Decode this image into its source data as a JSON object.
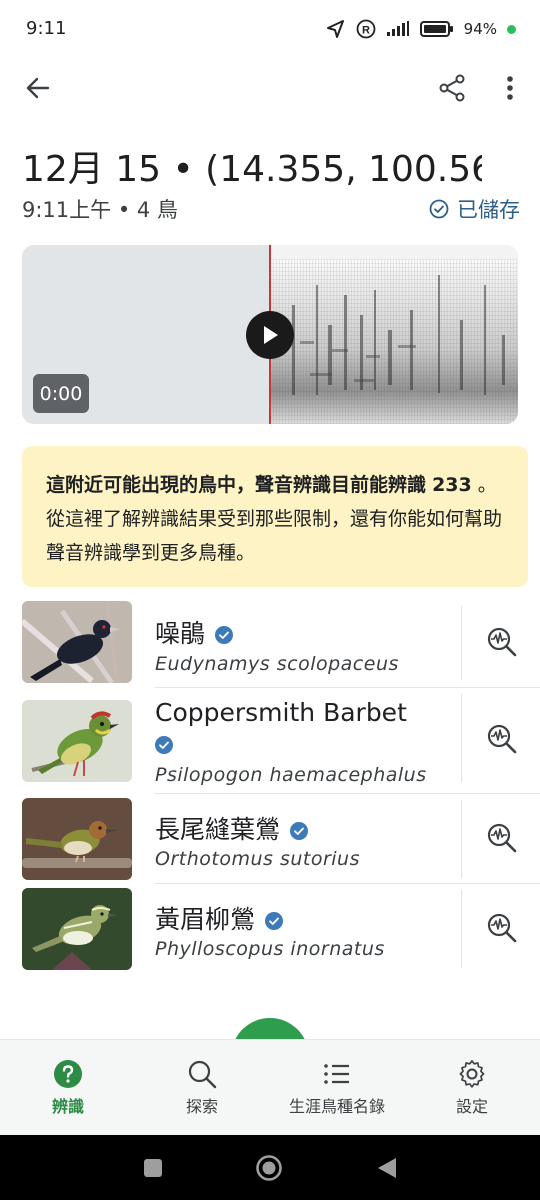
{
  "status_bar": {
    "time": "9:11",
    "battery": "94%"
  },
  "app_bar": {
    "back_icon": "arrow-left-icon",
    "share_icon": "share-icon",
    "more_icon": "more-vert-icon"
  },
  "recording": {
    "title": "12月 15 • (14.355, 100.56…",
    "meta": "9:11上午 • 4 鳥",
    "saved_label": "已儲存"
  },
  "player": {
    "time": "0:00",
    "play_icon": "play-icon"
  },
  "info": {
    "text_before": "這附近可能出現的鳥中，聲音辨識目前能辨識",
    "count": "233",
    "text_after": " 。 從這裡了解辨識結果受到那些限制，還有你能如何幫助聲音辨識學到更多鳥種。"
  },
  "birds": [
    {
      "name": "噪鵑",
      "scientific": "Eudynamys scolopaceus"
    },
    {
      "name": "Coppersmith Barbet",
      "scientific": "Psilopogon haemacephalus"
    },
    {
      "name": "長尾縫葉鶯",
      "scientific": "Orthotomus sutorius"
    },
    {
      "name": "黃眉柳鶯",
      "scientific": "Phylloscopus inornatus"
    }
  ],
  "bottom_nav": [
    {
      "label": "辨識",
      "icon": "help-circle-icon",
      "active": true
    },
    {
      "label": "探索",
      "icon": "search-icon",
      "active": false
    },
    {
      "label": "生涯鳥種名錄",
      "icon": "list-icon",
      "active": false
    },
    {
      "label": "設定",
      "icon": "gear-icon",
      "active": false
    }
  ],
  "colors": {
    "accent_green": "#2e8b46",
    "info_bg": "#fdf3c4",
    "verified_blue": "#3d7bb8",
    "saved_blue": "#2f5f88"
  }
}
